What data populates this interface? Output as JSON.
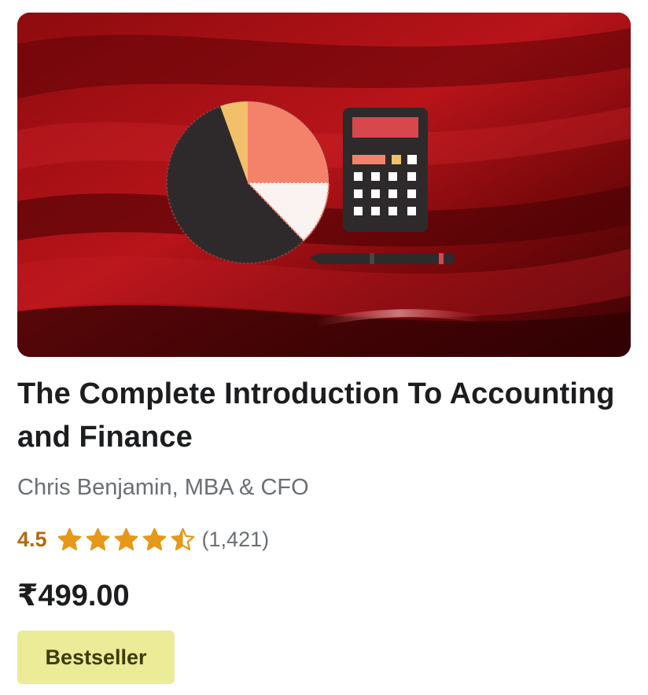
{
  "course": {
    "title": "The Complete Introduction To Accounting and Finance",
    "instructor": "Chris Benjamin, MBA & CFO",
    "rating": "4.5",
    "rating_stars": 4.5,
    "rating_count": "(1,421)",
    "price": "₹499.00",
    "badge": "Bestseller",
    "thumbnail_icons": [
      "pie-chart-icon",
      "calculator-icon",
      "pen-icon"
    ]
  },
  "colors": {
    "star": "#e59819",
    "rating_text": "#b4690e",
    "badge_bg": "#eceb98",
    "badge_text": "#3d3c0a",
    "muted_text": "#6a6f73",
    "thumbnail_bg": "#7a0a0d"
  }
}
